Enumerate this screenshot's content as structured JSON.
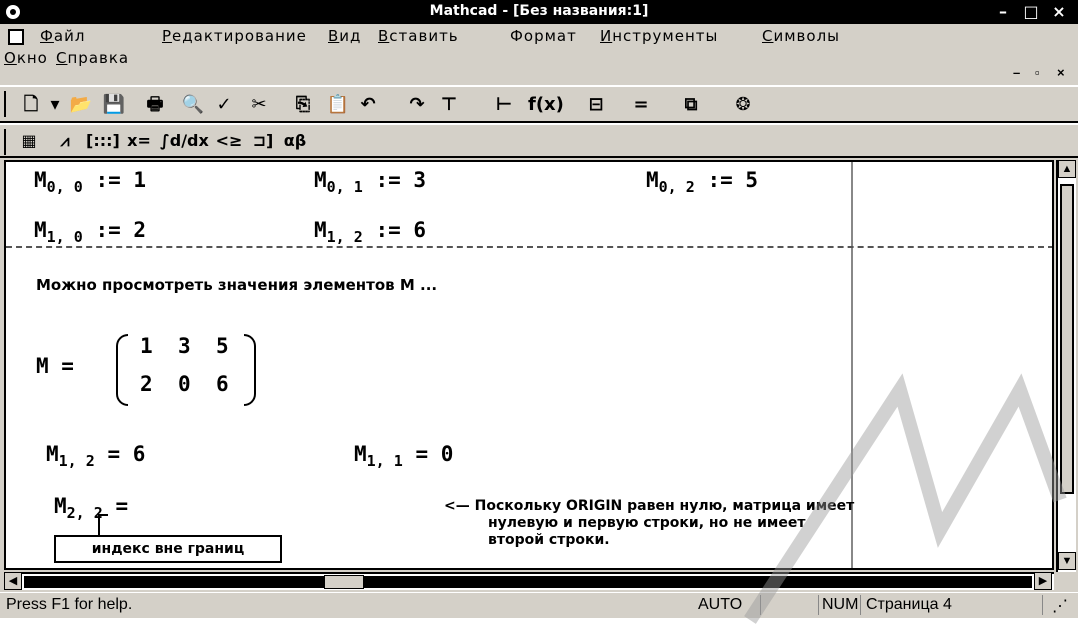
{
  "window": {
    "title": "Mathcad - [Без названия:1]",
    "controls": {
      "minimize": "–",
      "maximize": "□",
      "close": "×"
    }
  },
  "menu": {
    "row1": [
      {
        "label": "Файл",
        "accel": "Ф",
        "rest": "айл"
      },
      {
        "label": "Редактирование",
        "accel": "Р",
        "rest": "едактирование"
      },
      {
        "label": "Вид",
        "accel": "В",
        "rest": "ид"
      },
      {
        "label": "Вставить",
        "accel": "В",
        "rest": "ставить"
      },
      {
        "label": "Формат",
        "accel": "",
        "rest": "Формат"
      },
      {
        "label": "Инструменты",
        "accel": "И",
        "rest": "нструменты"
      },
      {
        "label": "Символы",
        "accel": "С",
        "rest": "имволы"
      }
    ],
    "row2": [
      {
        "label": "Окно",
        "accel": "О",
        "rest": "кно"
      },
      {
        "label": "Справка",
        "accel": "С",
        "rest": "правка"
      }
    ]
  },
  "toolbar_standard": [
    {
      "name": "new-document-icon",
      "glyph": "🗋"
    },
    {
      "name": "dropdown-arrow-icon",
      "glyph": "▾"
    },
    {
      "name": "open-folder-icon",
      "glyph": "📂"
    },
    {
      "name": "save-disk-icon",
      "glyph": "💾"
    },
    {
      "name": "print-icon",
      "glyph": "🖶"
    },
    {
      "name": "print-preview-icon",
      "glyph": "🔍"
    },
    {
      "name": "spell-check-icon",
      "glyph": "✓"
    },
    {
      "name": "cut-icon",
      "glyph": "✂"
    },
    {
      "name": "copy-icon",
      "glyph": "⎘"
    },
    {
      "name": "paste-icon",
      "glyph": "📋"
    },
    {
      "name": "undo-icon",
      "glyph": "↶"
    },
    {
      "name": "redo-icon",
      "glyph": "↷"
    },
    {
      "name": "align-horizontal-icon",
      "glyph": "⊤"
    },
    {
      "name": "align-vertical-icon",
      "glyph": "⊢"
    },
    {
      "name": "insert-function-icon",
      "glyph": "f(x)"
    },
    {
      "name": "insert-unit-icon",
      "glyph": "⊟"
    },
    {
      "name": "calculate-icon",
      "glyph": "="
    },
    {
      "name": "component-icon",
      "glyph": "⧉"
    },
    {
      "name": "resource-center-icon",
      "glyph": "❂"
    }
  ],
  "toolbar_math": [
    {
      "name": "calculator-toolbar-icon",
      "glyph": "▦"
    },
    {
      "name": "graph-toolbar-icon",
      "glyph": "⩘"
    },
    {
      "name": "matrix-toolbar-icon",
      "glyph": "[:::]"
    },
    {
      "name": "evaluation-toolbar-icon",
      "glyph": "x="
    },
    {
      "name": "calculus-toolbar-icon",
      "glyph": "∫d/dx"
    },
    {
      "name": "boolean-toolbar-icon",
      "glyph": "<≥"
    },
    {
      "name": "programming-toolbar-icon",
      "glyph": "⊐]"
    },
    {
      "name": "greek-toolbar-icon",
      "glyph": "αβ"
    }
  ],
  "worksheet": {
    "defs": [
      {
        "var": "M",
        "sub": "0, 0",
        "op": ":=",
        "val": "1"
      },
      {
        "var": "M",
        "sub": "0, 1",
        "op": ":=",
        "val": "3"
      },
      {
        "var": "M",
        "sub": "0, 2",
        "op": ":=",
        "val": "5"
      },
      {
        "var": "M",
        "sub": "1, 0",
        "op": ":=",
        "val": "2"
      },
      {
        "var": "M",
        "sub": "1, 2",
        "op": ":=",
        "val": "6"
      }
    ],
    "text_region": "Можно просмотреть значения элементов M ...",
    "matrix_eval": {
      "lhs": "M =",
      "rows": [
        [
          "1",
          "3",
          "5"
        ],
        [
          "2",
          "0",
          "6"
        ]
      ]
    },
    "evals": [
      {
        "var": "M",
        "sub": "1, 2",
        "op": "=",
        "val": "6"
      },
      {
        "var": "M",
        "sub": "1, 1",
        "op": "=",
        "val": "0"
      },
      {
        "var": "M",
        "sub": "2, 2",
        "op": "=",
        "val": ""
      }
    ],
    "error_message": "индекс вне границ",
    "comment_lines": [
      "<— Поскольку ORIGIN равен нулю, матрица имеет",
      "нулевую и первую строки, но не имеет",
      "второй строки."
    ]
  },
  "statusbar": {
    "help": "Press F1 for help.",
    "calc_mode": "AUTO",
    "num": "NUM",
    "page": "Страница 4"
  }
}
